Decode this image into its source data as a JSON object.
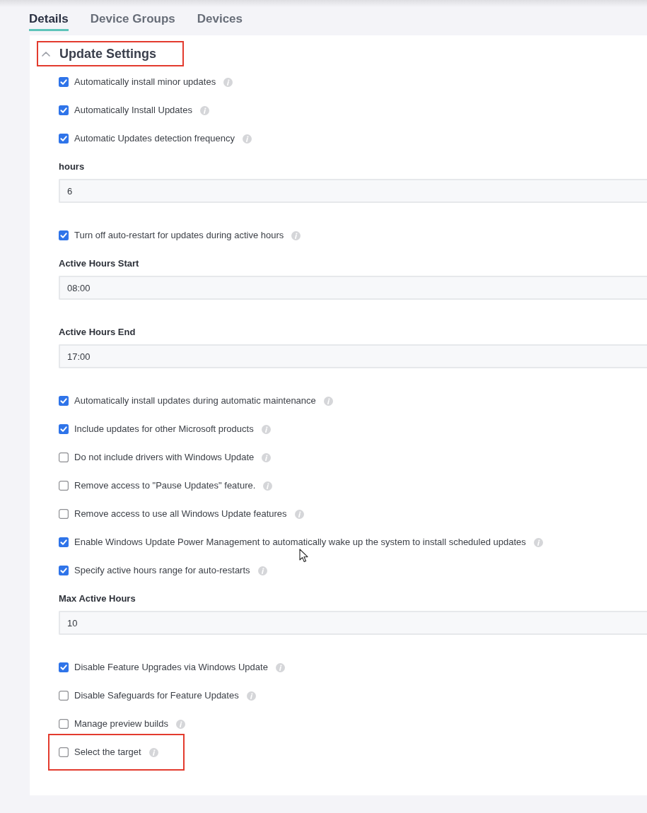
{
  "tabs": [
    {
      "label": "Details",
      "selected": true
    },
    {
      "label": "Device Groups",
      "selected": false
    },
    {
      "label": "Devices",
      "selected": false
    }
  ],
  "section": {
    "title": "Update Settings",
    "expanded": true,
    "highlighted": true,
    "items": [
      {
        "kind": "checkbox",
        "label": "Automatically install minor updates",
        "checked": true,
        "highlighted": false
      },
      {
        "kind": "checkbox",
        "label": "Automatically Install Updates",
        "checked": true,
        "highlighted": false
      },
      {
        "kind": "checkbox",
        "label": "Automatic Updates detection frequency",
        "checked": true,
        "highlighted": false
      },
      {
        "kind": "field",
        "label": "hours",
        "value": "6",
        "highlighted": false
      },
      {
        "kind": "checkbox",
        "label": "Turn off auto-restart for updates during active hours",
        "checked": true,
        "highlighted": false
      },
      {
        "kind": "field",
        "label": "Active Hours Start",
        "value": "08:00",
        "highlighted": false
      },
      {
        "kind": "field",
        "label": "Active Hours End",
        "value": "17:00",
        "highlighted": false
      },
      {
        "kind": "checkbox",
        "label": "Automatically install updates during automatic maintenance",
        "checked": true,
        "highlighted": false
      },
      {
        "kind": "checkbox",
        "label": "Include updates for other Microsoft products",
        "checked": true,
        "highlighted": false
      },
      {
        "kind": "checkbox",
        "label": "Do not include drivers with Windows Update",
        "checked": false,
        "highlighted": false
      },
      {
        "kind": "checkbox",
        "label": "Remove access to \"Pause Updates\" feature.",
        "checked": false,
        "highlighted": false
      },
      {
        "kind": "checkbox",
        "label": "Remove access to use all Windows Update features",
        "checked": false,
        "highlighted": false
      },
      {
        "kind": "checkbox",
        "label": "Enable Windows Update Power Management to automatically wake up the system to install scheduled updates",
        "checked": true,
        "highlighted": false
      },
      {
        "kind": "checkbox",
        "label": "Specify active hours range for auto-restarts",
        "checked": true,
        "highlighted": false
      },
      {
        "kind": "field",
        "label": "Max Active Hours",
        "value": "10",
        "highlighted": false
      },
      {
        "kind": "checkbox",
        "label": "Disable Feature Upgrades via Windows Update",
        "checked": true,
        "highlighted": false
      },
      {
        "kind": "checkbox",
        "label": "Disable Safeguards for Feature Updates",
        "checked": false,
        "highlighted": false
      },
      {
        "kind": "checkbox",
        "label": "Manage preview builds",
        "checked": false,
        "highlighted": false
      },
      {
        "kind": "checkbox",
        "label": "Select the target",
        "checked": false,
        "highlighted": true
      }
    ]
  }
}
